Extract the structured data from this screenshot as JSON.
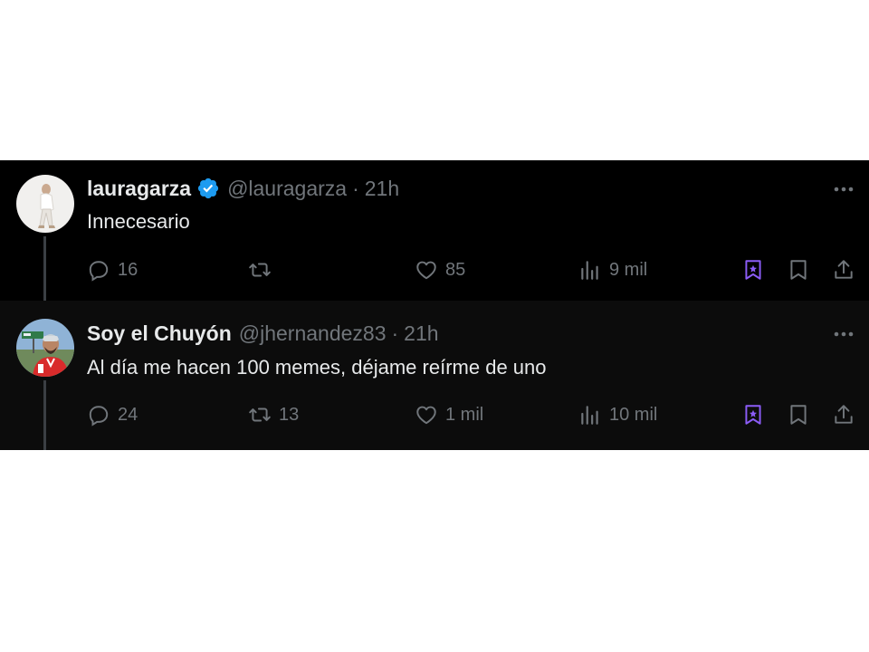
{
  "tweets": [
    {
      "display_name": "lauragarza",
      "verified": true,
      "handle": "@lauragarza",
      "separator": "·",
      "time": "21h",
      "text": "Innecesario",
      "reply_count": "16",
      "retweet_count": "",
      "like_count": "85",
      "view_count": "9 mil"
    },
    {
      "display_name": "Soy el Chuyón",
      "verified": false,
      "handle": "@jhernandez83",
      "separator": "·",
      "time": "21h",
      "text": "Al día me hacen 100 memes, déjame reírme de uno",
      "reply_count": "24",
      "retweet_count": "13",
      "like_count": "1 mil",
      "view_count": "10 mil"
    }
  ],
  "colors": {
    "background": "#000000",
    "reply_background": "#0c0c0c",
    "primary_text": "#e7e9ea",
    "secondary_text": "#71767b",
    "verified_blue": "#1d9bf0",
    "grok_purple": "#8b5cf6"
  },
  "icons": [
    "reply-icon",
    "retweet-icon",
    "like-icon",
    "views-icon",
    "grok-icon",
    "bookmark-icon",
    "share-icon",
    "more-icon",
    "verified-icon"
  ]
}
